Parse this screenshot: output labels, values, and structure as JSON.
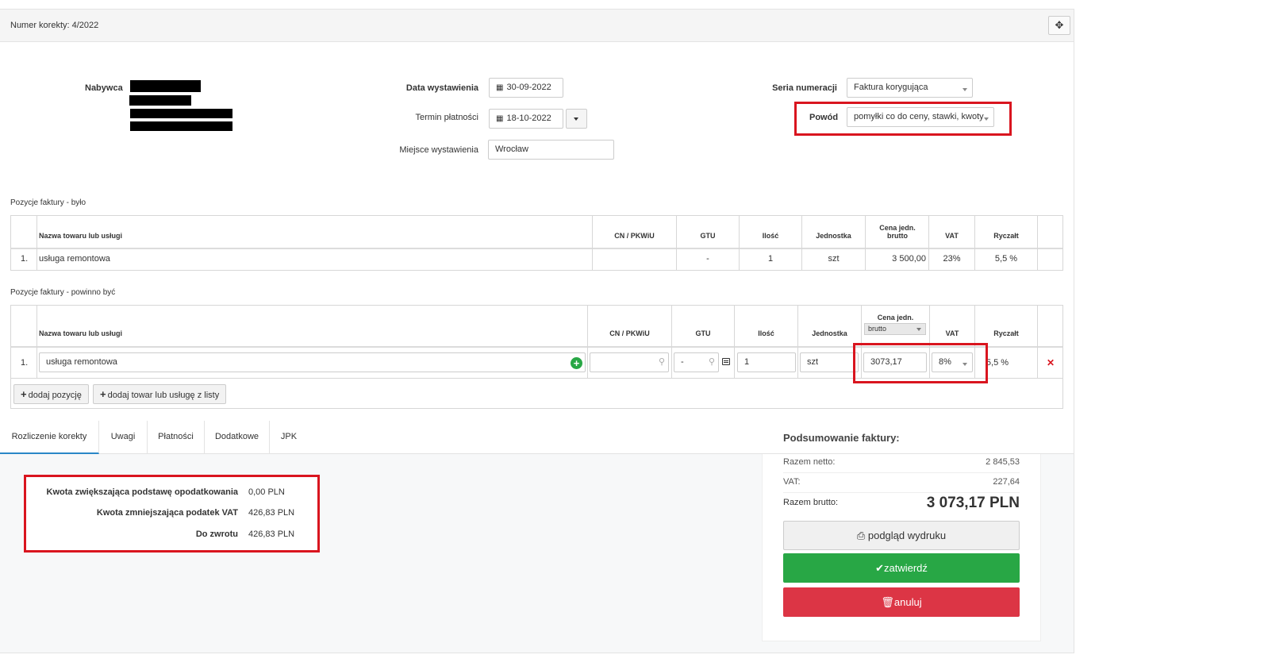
{
  "header": {
    "title": "Numer korekty: 4/2022",
    "move_icon": "arrows-move-icon"
  },
  "buyer": {
    "label": "Nabywca"
  },
  "dates": {
    "issue_label": "Data wystawienia",
    "issue_value": "30-09-2022",
    "due_label": "Termin płatności",
    "due_value": "18-10-2022",
    "place_label": "Miejsce wystawienia",
    "place_value": "Wrocław"
  },
  "series": {
    "label": "Seria numeracji",
    "value": "Faktura korygująca",
    "reason_label": "Powód",
    "reason_value": "pomyłki co do ceny, stawki, kwoty"
  },
  "table_before": {
    "title": "Pozycje faktury - było",
    "headers": [
      "Nazwa towaru lub usługi",
      "CN / PKWiU",
      "GTU",
      "Ilość",
      "Jednostka",
      "Cena jedn. brutto",
      "VAT",
      "Ryczałt"
    ],
    "rows": [
      {
        "no": "1.",
        "name": "usługa remontowa",
        "cn": "",
        "gtu": "-",
        "qty": "1",
        "unit": "szt",
        "price": "3 500,00",
        "vat": "23%",
        "flat": "5,5 %"
      }
    ]
  },
  "table_after": {
    "title": "Pozycje faktury - powinno być",
    "headers": [
      "Nazwa towaru lub usługi",
      "CN / PKWiU",
      "GTU",
      "Ilość",
      "Jednostka",
      "Cena jedn.",
      "VAT",
      "Ryczałt"
    ],
    "price_type": "brutto",
    "rows": [
      {
        "no": "1.",
        "name": "usługa remontowa",
        "cn": "",
        "gtu": "-",
        "qty": "1",
        "unit": "szt",
        "price": "3073,17",
        "vat": "8%",
        "flat": "5,5 %"
      }
    ],
    "add_position": "dodaj pozycję",
    "add_from_list": "dodaj towar lub usługę z listy"
  },
  "tabs": [
    "Rozliczenie korekty",
    "Uwagi",
    "Płatności",
    "Dodatkowe",
    "JPK"
  ],
  "settlement": {
    "increase_label": "Kwota zwiększająca podstawę opodatkowania",
    "increase_value": "0,00 PLN",
    "decrease_label": "Kwota zmniejszająca podatek VAT",
    "decrease_value": "426,83 PLN",
    "refund_label": "Do zwrotu",
    "refund_value": "426,83 PLN"
  },
  "summary": {
    "title": "Podsumowanie faktury:",
    "net_label": "Razem netto:",
    "net_value": "2 845,53",
    "vat_label": "VAT:",
    "vat_value": "227,64",
    "gross_label": "Razem brutto:",
    "gross_value": "3 073,17 PLN",
    "print_label": "podgląd wydruku",
    "confirm_label": "zatwierdź",
    "cancel_label": "anuluj"
  },
  "colors": {
    "highlight": "#d9151f",
    "confirm": "#28a745",
    "cancel": "#dc3545",
    "tab_active": "#2a87c7"
  }
}
